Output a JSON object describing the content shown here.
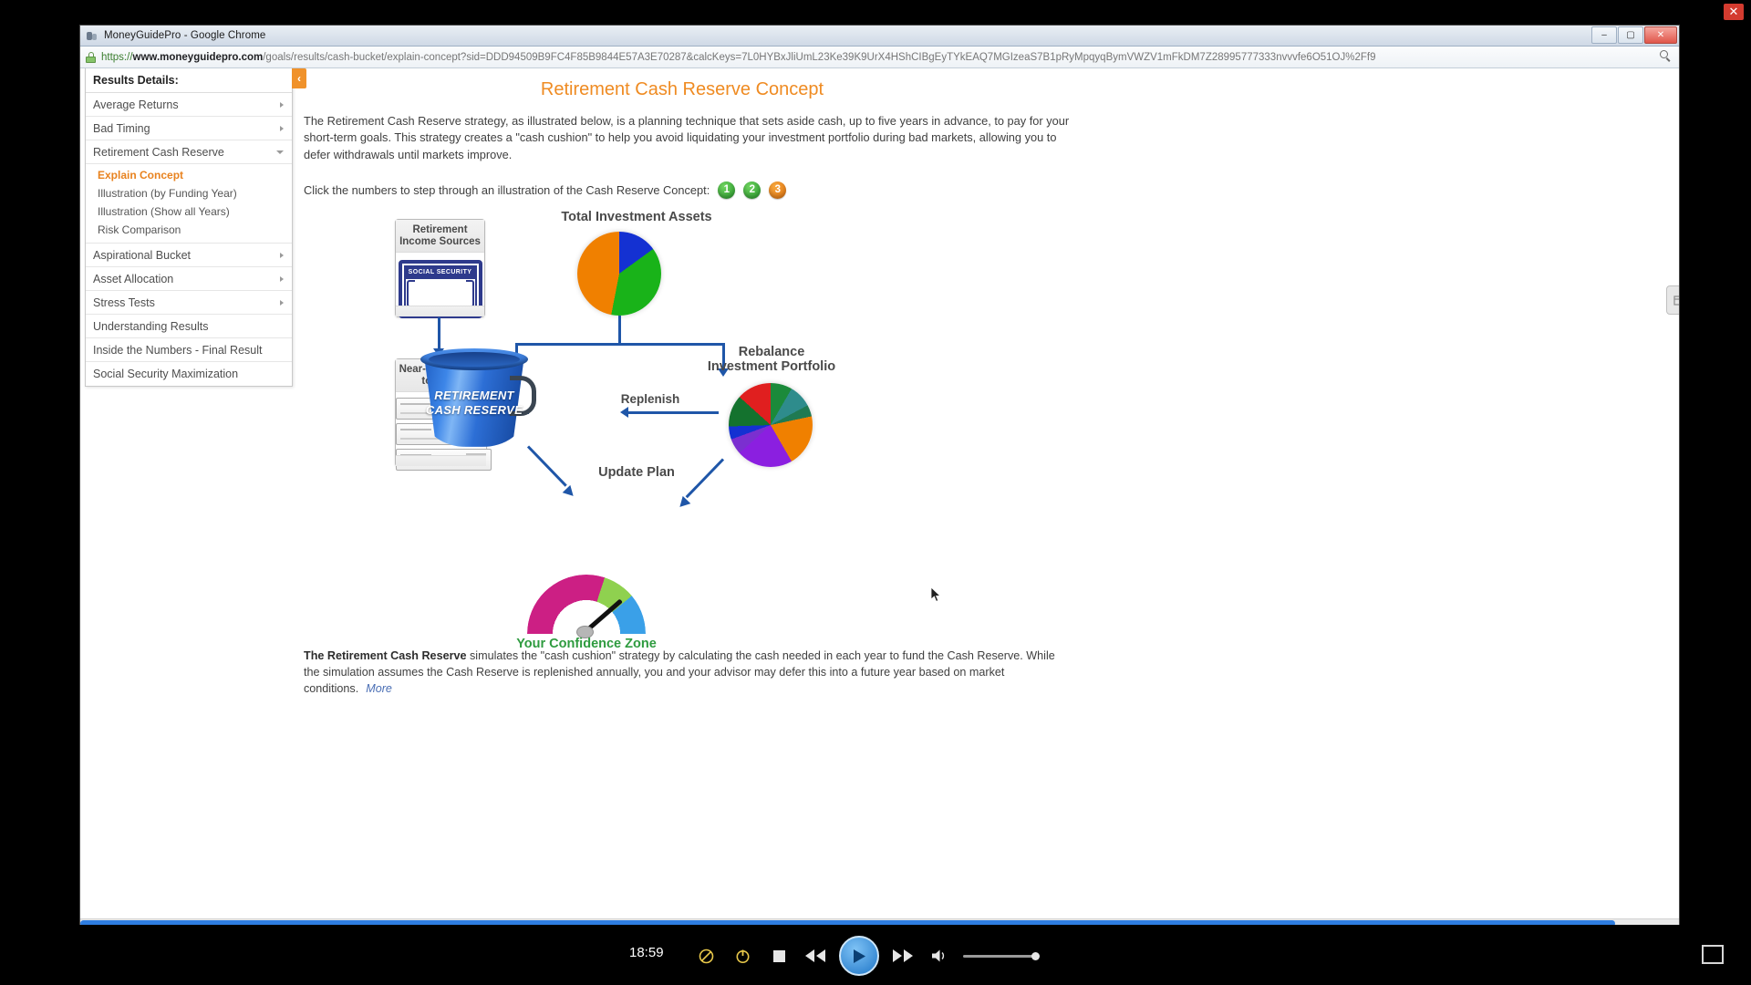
{
  "window": {
    "title": "MoneyGuidePro - Google Chrome",
    "minimize": "–",
    "maximize": "▢",
    "close": "✕",
    "url_scheme": "https://",
    "url_host": "www.moneyguidepro.com",
    "url_path": "/goals/results/cash-bucket/explain-concept?sid=DDD94509B9FC4F85B9844E57A3E70287&calcKeys=7L0HYBxJliUmL23Ke39K9UrX4HShCIBgEyTYkEAQ7MGIzeaS7B1pRyMpqyqBymVWZV1mFkDM7Z28995777333nvvvfe6O51OJ%2Ff9",
    "search_icon": "search-icon",
    "lock_icon": "lock-icon"
  },
  "sidebar": {
    "heading": "Results Details:",
    "collapse_icon": "chevron-left-icon",
    "items": [
      {
        "label": "Average Returns",
        "arrow": "right"
      },
      {
        "label": "Bad Timing",
        "arrow": "right"
      },
      {
        "label": "Retirement Cash Reserve",
        "arrow": "down"
      }
    ],
    "sub_items": [
      {
        "label": "Explain Concept",
        "active": true
      },
      {
        "label": "Illustration (by Funding Year)",
        "active": false
      },
      {
        "label": "Illustration (Show all Years)",
        "active": false
      },
      {
        "label": "Risk Comparison",
        "active": false
      }
    ],
    "items_after": [
      {
        "label": "Aspirational Bucket",
        "arrow": "right"
      },
      {
        "label": "Asset Allocation",
        "arrow": "right"
      },
      {
        "label": "Stress Tests",
        "arrow": "right"
      },
      {
        "label": "Understanding Results",
        "arrow": "none"
      },
      {
        "label": "Inside the Numbers - Final Result",
        "arrow": "none"
      },
      {
        "label": "Social Security Maximization",
        "arrow": "none"
      }
    ]
  },
  "page": {
    "title": "Retirement Cash Reserve Concept",
    "intro": "The Retirement Cash Reserve strategy, as illustrated below, is a planning technique that sets aside cash, up to five years in advance, to pay for your short-term goals. This strategy creates a \"cash cushion\" to help you avoid liquidating your investment portfolio during bad markets, allowing you to defer withdrawals until markets improve.",
    "click_text": "Click the numbers to step through an illustration of the Cash Reserve Concept:",
    "steps": [
      {
        "label": "1",
        "color": "#2d9b2f"
      },
      {
        "label": "2",
        "color": "#2d9b2f"
      },
      {
        "label": "3",
        "color": "#e1720d"
      }
    ],
    "footer_bold": "The Retirement Cash Reserve",
    "footer_text": " simulates the \"cash cushion\" strategy by calculating the cash needed in each year to fund the Cash Reserve. While the simulation assumes the Cash Reserve is replenished annually, you and your advisor may defer this into a future year based on market conditions.",
    "more_link": "More",
    "side_tab_icon": "side-tab-icon"
  },
  "diagram": {
    "total_assets_label": "Total Investment Assets",
    "income_sources_label": "Retirement Income Sources",
    "social_security_label": "SOCIAL SECURITY",
    "near_term_label": "Near-Term Goals to Fund",
    "bucket_label_line1": "RETIREMENT",
    "bucket_label_line2": "CASH RESERVE",
    "replenish_label": "Replenish",
    "rebalance_label_line1": "Rebalance",
    "rebalance_label_line2": "Investment Portfolio",
    "update_plan_label": "Update Plan",
    "confidence_label": "Your Confidence Zone",
    "colors": {
      "line": "#1f56a8",
      "bucket": "#2d6fd6",
      "title_orange": "#ef8b22",
      "confidence_green": "#2e9b3f"
    }
  },
  "chart_data": [
    {
      "type": "pie",
      "title": "Total Investment Assets",
      "labels": [
        "Orange allocation",
        "Green allocation",
        "Blue allocation"
      ],
      "values": [
        47,
        38,
        15
      ],
      "colors": [
        "#F08000",
        "#19B319",
        "#1431D2"
      ]
    },
    {
      "type": "pie",
      "title": "Rebalance Investment Portfolio",
      "labels": [
        "Green",
        "Teal",
        "Orange",
        "Purple",
        "Violet",
        "Blue",
        "Dark green",
        "Red"
      ],
      "values": [
        13,
        9,
        19,
        22,
        6,
        5,
        12,
        14
      ],
      "colors": [
        "#1B8A3A",
        "#2E8C8C",
        "#F08000",
        "#8B1FE0",
        "#7B2FD0",
        "#1431D2",
        "#14722E",
        "#E01F1F"
      ]
    },
    {
      "type": "gauge",
      "title": "Your Confidence Zone",
      "segments": [
        {
          "name": "below",
          "color": "#CC1F84",
          "span_deg": 108
        },
        {
          "name": "zone",
          "color": "#8FD14F",
          "span_deg": 32
        },
        {
          "name": "above",
          "color": "#3AA0E8",
          "span_deg": 40
        }
      ],
      "needle_angle_deg": 139
    }
  ],
  "player": {
    "timecode": "18:59",
    "buttons": [
      {
        "name": "mute-annotations-icon",
        "label": "⊘"
      },
      {
        "name": "power-icon",
        "label": "⏻"
      },
      {
        "name": "stop-icon",
        "label": "■"
      },
      {
        "name": "rewind-icon",
        "label": "◀◀"
      },
      {
        "name": "play-icon",
        "label": "▶"
      },
      {
        "name": "fast-forward-icon",
        "label": "▶▶"
      },
      {
        "name": "volume-icon",
        "label": "🔊"
      }
    ],
    "fullscreen_icon": "fullscreen-icon",
    "close_icon": "✕"
  }
}
